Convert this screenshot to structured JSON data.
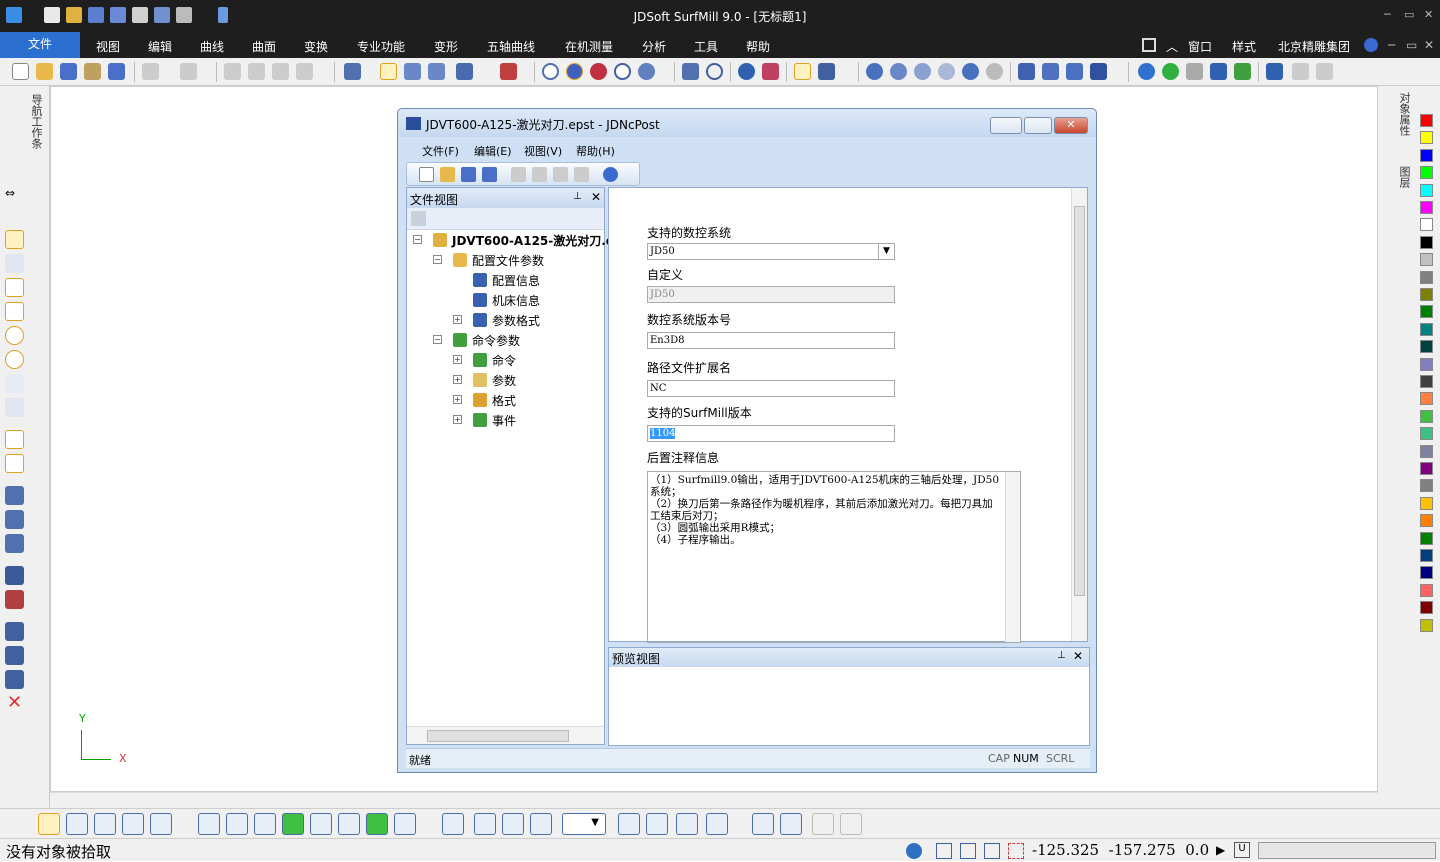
{
  "app": {
    "title": "JDSoft SurfMill 9.0 - [无标题1]"
  },
  "menu": {
    "file": "文件",
    "items": [
      "视图",
      "编辑",
      "曲线",
      "曲面",
      "变换",
      "专业功能",
      "变形",
      "五轴曲线",
      "在机测量",
      "分析",
      "工具",
      "帮助"
    ],
    "right": [
      "窗口",
      "样式",
      "北京精雕集团"
    ]
  },
  "left_panel": {
    "label": "导航工作条"
  },
  "right_panel": {
    "label1": "对象属性",
    "label2": "图层"
  },
  "colors": {
    "accent": "#2b6fd0",
    "swatches": [
      "#ff0000",
      "#ffff00",
      "#0000ff",
      "#00ff00",
      "#00ffff",
      "#ff00ff",
      "#ffffff",
      "#000000",
      "#c0c0c0",
      "#808080",
      "#808000",
      "#008000",
      "#008080",
      "#004040",
      "#8080c0",
      "#404040",
      "#ff8040",
      "#40c040",
      "#40c080",
      "#8080a0",
      "#800080",
      "#808080",
      "#ffc000",
      "#ff8000",
      "#008000",
      "#004080",
      "#000080",
      "#ff6060",
      "#800000",
      "#c0c000"
    ]
  },
  "axis": {
    "x": "X",
    "y": "Y"
  },
  "dialog": {
    "title": "JDVT600-A125-激光对刀.epst - JDNcPost",
    "menu": [
      "文件(F)",
      "编辑(E)",
      "视图(V)",
      "帮助(H)"
    ],
    "file_view": {
      "title": "文件视图",
      "tree": [
        {
          "label": "JDVT600-A125-激光对刀.epst",
          "level": 0,
          "bold": true
        },
        {
          "label": "配置文件参数",
          "level": 1
        },
        {
          "label": "配置信息",
          "level": 2
        },
        {
          "label": "机床信息",
          "level": 2
        },
        {
          "label": "参数格式",
          "level": 2
        },
        {
          "label": "命令参数",
          "level": 1
        },
        {
          "label": "命令",
          "level": 2
        },
        {
          "label": "参数",
          "level": 2
        },
        {
          "label": "格式",
          "level": 2
        },
        {
          "label": "事件",
          "level": 2
        }
      ]
    },
    "props": {
      "cnc_label": "支持的数控系统",
      "cnc_value": "JD50",
      "custom_label": "自定义",
      "custom_value": "JD50",
      "version_label": "数控系统版本号",
      "version_value": "En3D8",
      "ext_label": "路径文件扩展名",
      "ext_value": "NC",
      "surfmill_label": "支持的SurfMill版本",
      "surfmill_value": "1104",
      "notes_label": "后置注释信息",
      "notes": [
        "（1）Surfmill9.0输出，适用于JDVT600-A125机床的三轴后处理，JD50系统；",
        "（2）换刀后第一条路径作为暖机程序，其前后添加激光对刀。每把刀具加工结束后对刀；",
        "（3）圆弧输出采用R模式；",
        "（4）子程序输出。"
      ]
    },
    "preview": {
      "title": "预览视图"
    },
    "status": {
      "ready": "就绪",
      "cap": "CAP",
      "num": "NUM",
      "scrl": "SCRL"
    }
  },
  "status": {
    "message": "没有对象被拾取",
    "coords": "-125.325  -157.275  0.0",
    "u": "U"
  }
}
